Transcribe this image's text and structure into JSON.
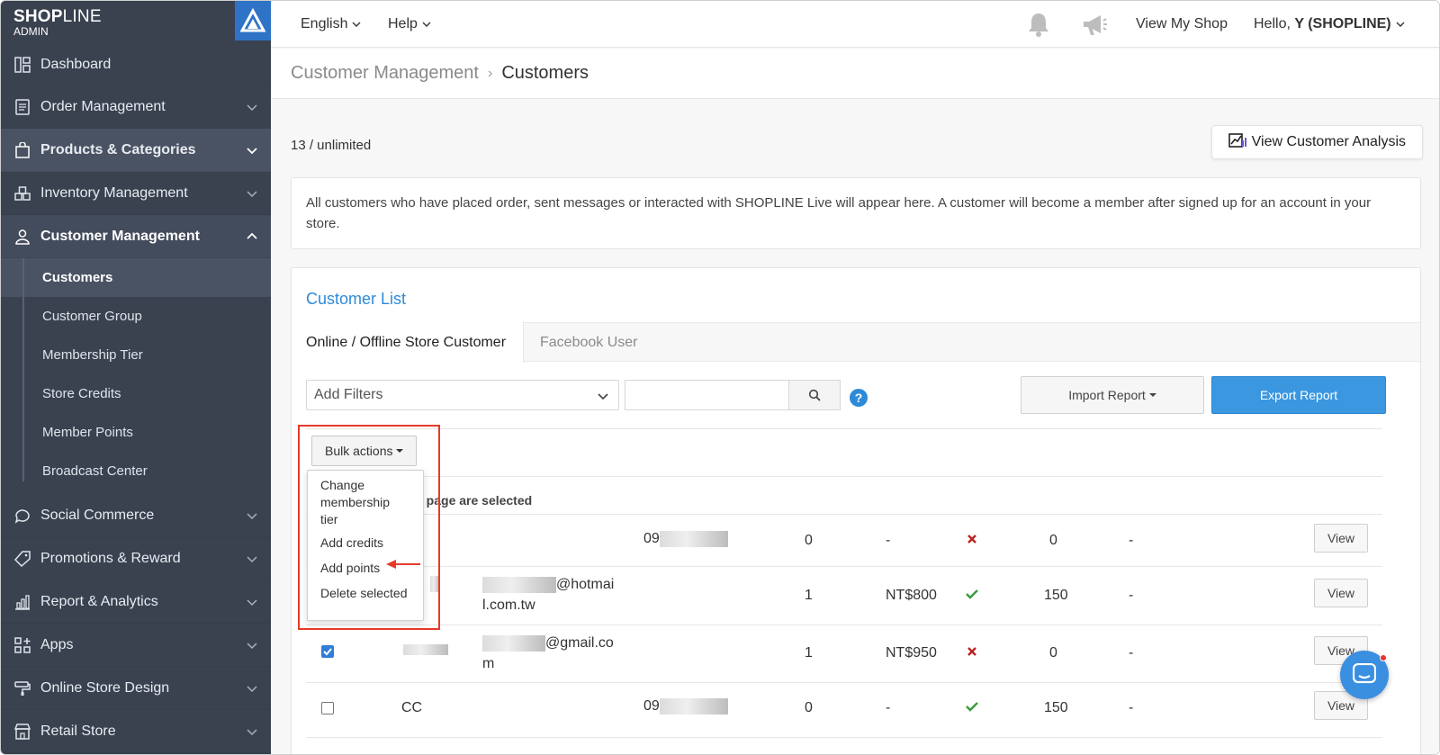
{
  "brand": {
    "logo_bold": "SHOP",
    "logo_thin": "LINE",
    "subtitle": "ADMIN"
  },
  "sidebar": {
    "items": [
      {
        "label": "Dashboard",
        "icon": "dashboard-icon"
      },
      {
        "label": "Order Management",
        "icon": "order-icon"
      },
      {
        "label": "Products & Categories",
        "icon": "bag-icon"
      },
      {
        "label": "Inventory Management",
        "icon": "inventory-icon"
      },
      {
        "label": "Customer Management",
        "icon": "user-icon"
      },
      {
        "label": "Social Commerce",
        "icon": "chat-icon"
      },
      {
        "label": "Promotions & Reward",
        "icon": "tag-icon"
      },
      {
        "label": "Report & Analytics",
        "icon": "chart-icon"
      },
      {
        "label": "Apps",
        "icon": "apps-icon"
      },
      {
        "label": "Online Store Design",
        "icon": "paint-icon"
      },
      {
        "label": "Retail Store",
        "icon": "store-icon"
      }
    ],
    "customer_sub": [
      "Customers",
      "Customer Group",
      "Membership Tier",
      "Store Credits",
      "Member Points",
      "Broadcast Center"
    ]
  },
  "topbar": {
    "language": "English",
    "help": "Help",
    "view_shop": "View My Shop",
    "greeting": "Hello, ",
    "user": "Y (SHOPLINE)"
  },
  "breadcrumb": {
    "parent": "Customer Management",
    "current": "Customers"
  },
  "main": {
    "count": "13 / unlimited",
    "analysis_button": "View Customer Analysis",
    "info": "All customers who have placed order, sent messages or interacted with SHOPLINE Live will appear here. A customer will become a member after signed up for an account in your store.",
    "list_title": "Customer List",
    "tabs": [
      "Online / Offline Store Customer",
      "Facebook User"
    ],
    "filter_placeholder": "Add Filters",
    "import_button": "Import Report",
    "export_button": "Export Report",
    "bulk_button": "Bulk actions",
    "selected_note": "s page are selected",
    "view_label": "View"
  },
  "bulk_menu": {
    "items": [
      "Change membership tier",
      "Add credits",
      "Add points",
      "Delete selected"
    ]
  },
  "rows": [
    {
      "name": "",
      "contact_prefix": "09",
      "contact_suffix": "",
      "orders": "0",
      "spent": "-",
      "member": false,
      "points": "0",
      "other": "-"
    },
    {
      "name": "",
      "contact_prefix": "",
      "contact_suffix": "@hotmail.com.tw",
      "orders": "1",
      "spent": "NT$800",
      "member": true,
      "points": "150",
      "other": "-"
    },
    {
      "name": "",
      "contact_prefix": "",
      "contact_suffix": "@gmail.com",
      "orders": "1",
      "spent": "NT$950",
      "member": false,
      "points": "0",
      "other": "-"
    },
    {
      "name": "CC",
      "contact_prefix": "09",
      "contact_suffix": "",
      "orders": "0",
      "spent": "-",
      "member": true,
      "points": "150",
      "other": "-"
    }
  ],
  "colors": {
    "sidebar": "#3a4250",
    "accent": "#2d8ad8",
    "export": "#3a97e0",
    "highlight_box": "#e53a2a"
  }
}
